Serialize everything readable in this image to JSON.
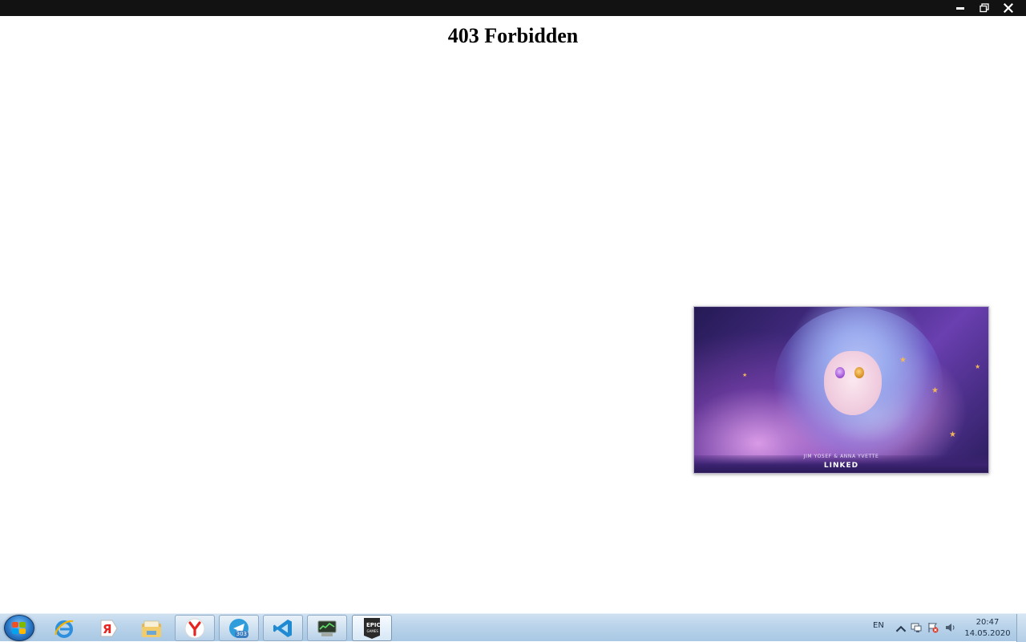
{
  "window": {
    "controls": [
      "minimize-icon",
      "restore-icon",
      "close-icon"
    ]
  },
  "page": {
    "heading": "403 Forbidden"
  },
  "media_overlay": {
    "artist": "JIM YOSEF & ANNA YVETTE",
    "title": "LINKED"
  },
  "taskbar": {
    "start_icon": "windows-start-icon",
    "apps": [
      {
        "icon": "internet-explorer-icon"
      },
      {
        "icon": "yandex-icon"
      },
      {
        "icon": "file-explorer-icon"
      },
      {
        "icon": "yandex-browser-icon"
      },
      {
        "icon": "telegram-icon",
        "badge": "303"
      },
      {
        "icon": "vscode-icon"
      },
      {
        "icon": "monitor-app-icon"
      },
      {
        "icon": "epic-games-icon",
        "label": "EPIC GAMES"
      }
    ],
    "tray": {
      "language": "EN",
      "time": "20:47",
      "date": "14.05.2020"
    }
  },
  "colors": {
    "titlebar": "#121212",
    "taskbar": "#b9d3ea"
  }
}
